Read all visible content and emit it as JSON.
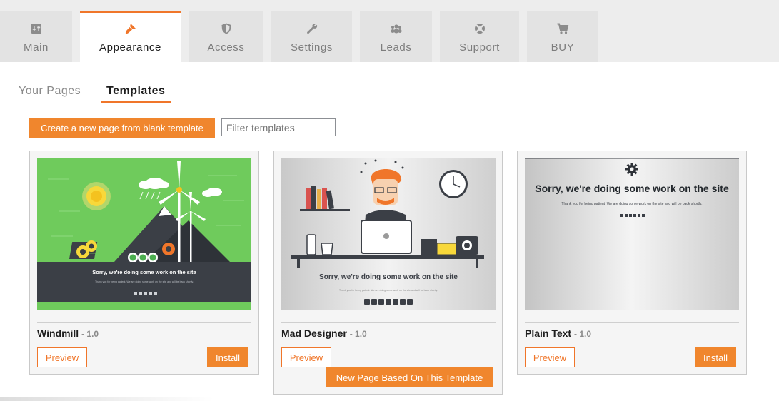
{
  "top_tabs": [
    {
      "label": "Main",
      "icon": "sliders-icon"
    },
    {
      "label": "Appearance",
      "icon": "paintbrush-icon"
    },
    {
      "label": "Access",
      "icon": "shield-icon"
    },
    {
      "label": "Settings",
      "icon": "wrench-icon"
    },
    {
      "label": "Leads",
      "icon": "users-icon"
    },
    {
      "label": "Support",
      "icon": "lifebuoy-icon"
    },
    {
      "label": "BUY",
      "icon": "cart-icon"
    }
  ],
  "active_top_tab": "Appearance",
  "sub_tabs": [
    "Your Pages",
    "Templates"
  ],
  "active_sub_tab": "Templates",
  "toolbar": {
    "create_label": "Create a new page from blank template",
    "filter_placeholder": "Filter templates"
  },
  "templates": [
    {
      "name": "Windmill",
      "version": "- 1.0",
      "preview_label": "Preview",
      "install_label": "Install",
      "thumb_heading": "Sorry, we're doing some work on the site",
      "thumb_text": "Thank you for being patient. We are doing some work on the site and will be back shortly."
    },
    {
      "name": "Mad Designer",
      "version": "- 1.0",
      "preview_label": "Preview",
      "new_page_label": "New Page Based On This Template",
      "thumb_heading": "Sorry, we're doing some work on the site",
      "thumb_text": "Thank you for being patient. We are doing some work on the site and will be back shortly."
    },
    {
      "name": "Plain Text",
      "version": "- 1.0",
      "preview_label": "Preview",
      "install_label": "Install",
      "thumb_heading": "Sorry, we're doing some work on the site",
      "thumb_text": "Thank you for being patient. We are doing some work on the site and will be back shortly."
    }
  ],
  "colors": {
    "accent": "#f0762a",
    "button": "#f0862d",
    "windmill_green": "#6fcb5c",
    "windmill_dark": "#3b3f46"
  }
}
